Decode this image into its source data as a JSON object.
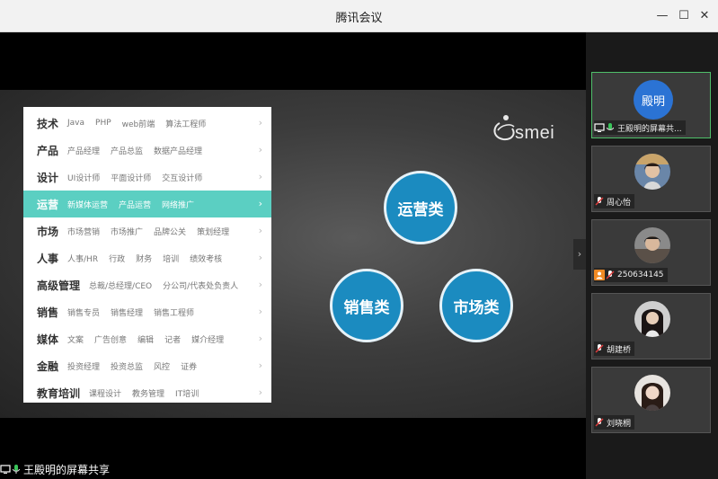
{
  "window": {
    "title": "腾讯会议",
    "minimize_glyph": "—",
    "maximize_glyph": "☐",
    "close_glyph": "✕"
  },
  "slide": {
    "menu": [
      {
        "category": "技术",
        "items": [
          "Java",
          "PHP",
          "web前端",
          "算法工程师"
        ],
        "active": false
      },
      {
        "category": "产品",
        "items": [
          "产品经理",
          "产品总监",
          "数据产品经理"
        ],
        "active": false
      },
      {
        "category": "设计",
        "items": [
          "UI设计师",
          "平面设计师",
          "交互设计师"
        ],
        "active": false
      },
      {
        "category": "运营",
        "items": [
          "新媒体运营",
          "产品运营",
          "网络推广"
        ],
        "active": true
      },
      {
        "category": "市场",
        "items": [
          "市场营销",
          "市场推广",
          "品牌公关",
          "策划经理"
        ],
        "active": false
      },
      {
        "category": "人事",
        "items": [
          "人事/HR",
          "行政",
          "财务",
          "培训",
          "绩效考核"
        ],
        "active": false
      },
      {
        "category": "高级管理",
        "items": [
          "总裁/总经理/CEO",
          "分公司/代表处负责人"
        ],
        "active": false
      },
      {
        "category": "销售",
        "items": [
          "销售专员",
          "销售经理",
          "销售工程师"
        ],
        "active": false
      },
      {
        "category": "媒体",
        "items": [
          "文案",
          "广告创意",
          "编辑",
          "记者",
          "媒介经理"
        ],
        "active": false
      },
      {
        "category": "金融",
        "items": [
          "投资经理",
          "投资总监",
          "风控",
          "证券"
        ],
        "active": false
      },
      {
        "category": "教育培训",
        "items": [
          "课程设计",
          "教务管理",
          "IT培训"
        ],
        "active": false
      }
    ],
    "chevron": "›",
    "logo_text": "smei",
    "circles": {
      "ops": "运营类",
      "sales": "销售类",
      "market": "市场类"
    },
    "accent_color": "#5bcfc2",
    "circle_color": "#1b8bc0"
  },
  "collapse_glyph": "›",
  "share_caption": "王殿明的屏幕共享",
  "participants": [
    {
      "name": "王殿明的屏幕共...",
      "avatar_text": "殿明",
      "speaking": true
    },
    {
      "name": "周心怡"
    },
    {
      "name": "250634145"
    },
    {
      "name": "胡建桥"
    },
    {
      "name": "刘晓桐"
    }
  ]
}
